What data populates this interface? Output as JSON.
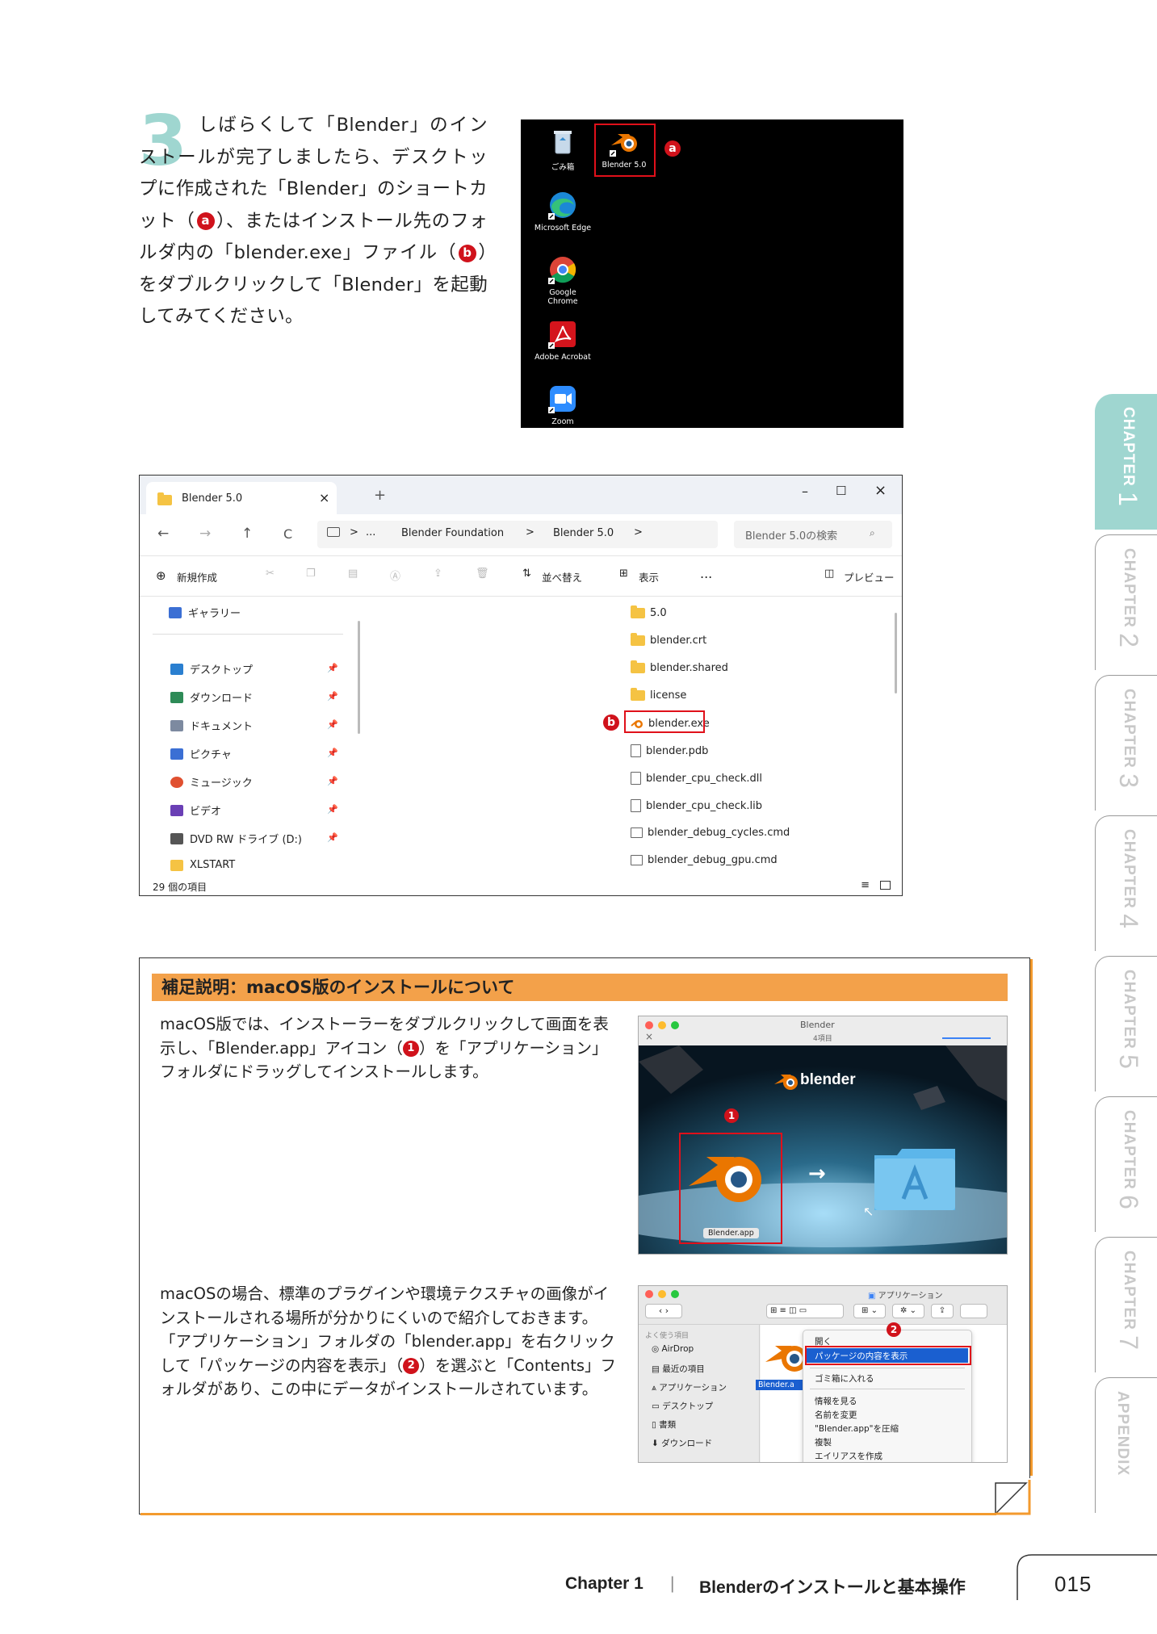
{
  "step": {
    "number": "3",
    "text_pre": "しばらくして「Blender」のインストールが完了しましたら、デスクトップに作成された「Blender」のショートカット（",
    "badge_a": "a",
    "text_mid": "）、またはインストール先のフォルダ内の「blender.exe」ファイル（",
    "badge_b": "b",
    "text_post": "）をダブルクリックして「Blender」を起動してみてください。"
  },
  "desktop": {
    "icons": [
      {
        "label": "ごみ箱",
        "icon": "recycle-bin-icon"
      },
      {
        "label": "Blender 5.0",
        "icon": "blender-icon"
      },
      {
        "label": "Microsoft Edge",
        "icon": "edge-icon"
      },
      {
        "label": "Google Chrome",
        "icon": "chrome-icon"
      },
      {
        "label": "Adobe Acrobat",
        "icon": "acrobat-icon"
      },
      {
        "label": "Zoom",
        "icon": "zoom-icon"
      }
    ],
    "marker": "a"
  },
  "explorer": {
    "tab_title": "Blender 5.0",
    "tab_close": "×",
    "new_tab": "+",
    "win_min": "–",
    "win_max": "☐",
    "win_close": "×",
    "nav": {
      "back": "←",
      "forward": "→",
      "up": "↑",
      "refresh": "C"
    },
    "breadcrumb": [
      "...",
      "Blender Foundation",
      "Blender 5.0"
    ],
    "sep": ">",
    "search_placeholder": "Blender 5.0の検索",
    "commands": {
      "new": "新規作成",
      "sort": "並べ替え",
      "view": "表示",
      "more": "...",
      "preview": "プレビュー"
    },
    "sidebar": [
      {
        "label": "ギャラリー",
        "color": "#3b6fd4"
      },
      {
        "label": "デスクトップ",
        "color": "#2a7fd0"
      },
      {
        "label": "ダウンロード",
        "color": "#2e8b57"
      },
      {
        "label": "ドキュメント",
        "color": "#7d8aa0"
      },
      {
        "label": "ピクチャ",
        "color": "#3b6fd4"
      },
      {
        "label": "ミュージック",
        "color": "#e05030"
      },
      {
        "label": "ビデオ",
        "color": "#6a3fb5"
      },
      {
        "label": "DVD RW ドライブ (D:)",
        "color": "#555555"
      },
      {
        "label": "XLSTART",
        "color": "#f5c343"
      }
    ],
    "files": [
      {
        "name": "5.0",
        "type": "folder"
      },
      {
        "name": "blender.crt",
        "type": "folder"
      },
      {
        "name": "blender.shared",
        "type": "folder"
      },
      {
        "name": "license",
        "type": "folder"
      },
      {
        "name": "blender.exe",
        "type": "exe"
      },
      {
        "name": "blender.pdb",
        "type": "doc"
      },
      {
        "name": "blender_cpu_check.dll",
        "type": "dll"
      },
      {
        "name": "blender_cpu_check.lib",
        "type": "doc"
      },
      {
        "name": "blender_debug_cycles.cmd",
        "type": "cmd"
      },
      {
        "name": "blender_debug_gpu.cmd",
        "type": "cmd"
      }
    ],
    "marker": "b",
    "status": "29 個の項目"
  },
  "supplement": {
    "title": "補足説明：macOS版のインストールについて",
    "para1_pre": "macOS版では、インストーラーをダブルクリックして画面を表示し、「Blender.app」アイコン（",
    "para1_badge": "1",
    "para1_post": "）を「アプリケーション」フォルダにドラッグしてインストールします。",
    "para2_pre": "macOSの場合、標準のプラグインや環境テクスチャの画像がインストールされる場所が分かりにくいので紹介しておきます。「アプリケーション」フォルダの「blender.app」を右クリックして「パッケージの内容を表示」（",
    "para2_badge": "2",
    "para2_post": "）を選ぶと「Contents」フォルダがあり、この中にデータがインストールされています。",
    "installer": {
      "title": "Blender",
      "count": "4項目",
      "logo": "blender",
      "app_label": "Blender.app",
      "marker": "1"
    },
    "finder": {
      "title": "アプリケーション",
      "sidebar_header": "よく使う項目",
      "sidebar": [
        "AirDrop",
        "最近の項目",
        "アプリケーション",
        "デスクトップ",
        "書類",
        "ダウンロード"
      ],
      "app_label": "Blender.a",
      "menu": [
        "開く",
        "パッケージの内容を表示",
        "ゴミ箱に入れる",
        "情報を見る",
        "名前を変更",
        "\"Blender.app\"を圧縮",
        "複製",
        "エイリアスを作成"
      ],
      "marker": "2"
    }
  },
  "chapters": [
    {
      "word": "CHAPTER",
      "num": "1",
      "active": true
    },
    {
      "word": "CHAPTER",
      "num": "2",
      "active": false
    },
    {
      "word": "CHAPTER",
      "num": "3",
      "active": false
    },
    {
      "word": "CHAPTER",
      "num": "4",
      "active": false
    },
    {
      "word": "CHAPTER",
      "num": "5",
      "active": false
    },
    {
      "word": "CHAPTER",
      "num": "6",
      "active": false
    },
    {
      "word": "CHAPTER",
      "num": "7",
      "active": false
    },
    {
      "word": "APPENDIX",
      "num": "",
      "active": false
    }
  ],
  "footer": {
    "chapter": "Chapter 1",
    "divider": "|",
    "title": "Blenderのインストールと基本操作",
    "page": "015"
  },
  "colors": {
    "accent_teal": "#9fd6d0",
    "marker_red": "#d0121b",
    "header_orange": "#f3a14a"
  }
}
